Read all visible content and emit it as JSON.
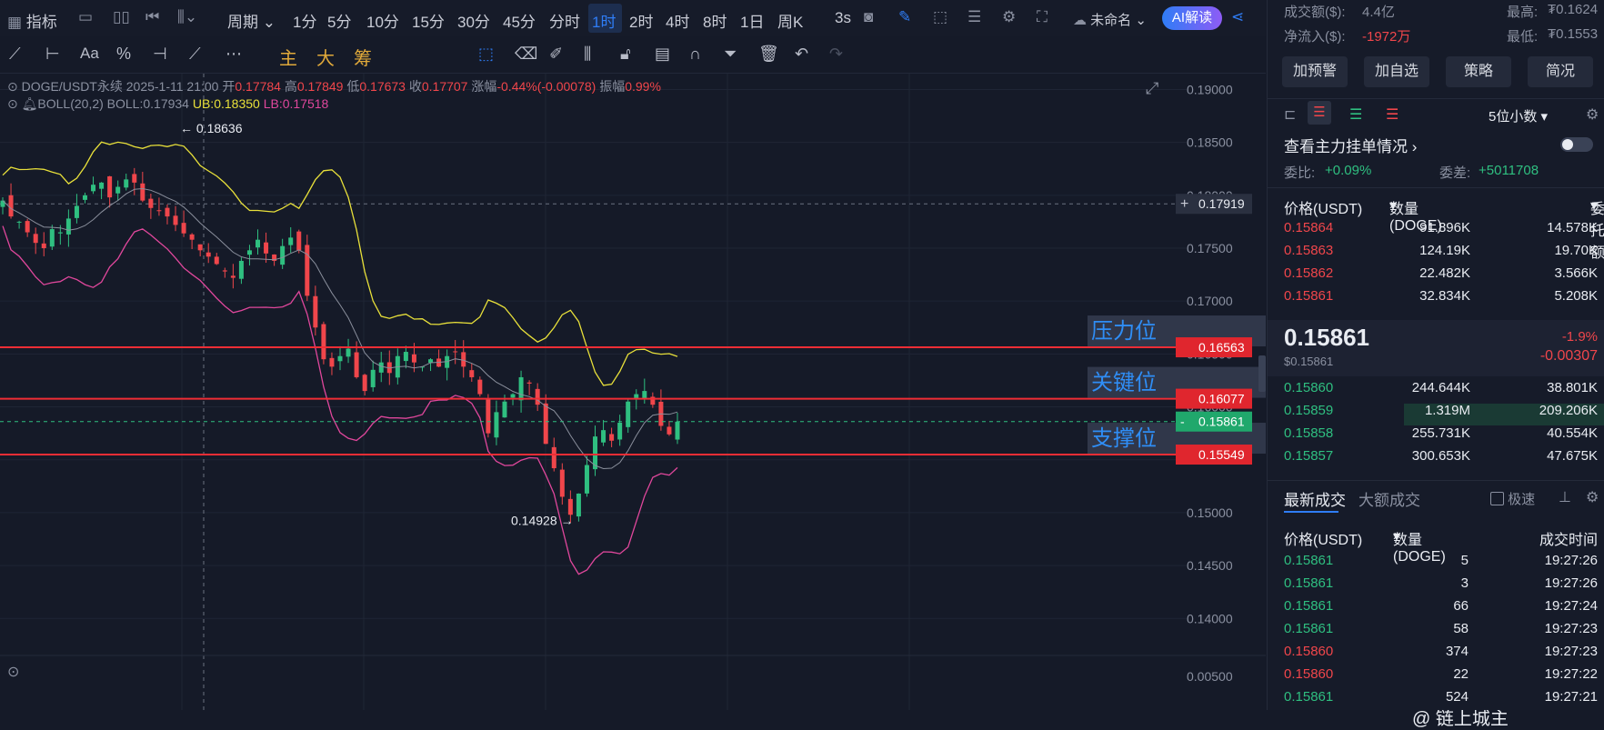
{
  "toolbar": {
    "indicators_label": "指标",
    "period_label": "周期",
    "intervals": [
      "1分",
      "5分",
      "10分",
      "15分",
      "30分",
      "45分",
      "分时",
      "1时",
      "2时",
      "4时",
      "8时",
      "1日",
      "周K"
    ],
    "selected_interval": "1时",
    "refresh_label": "3s",
    "layout_label": "未命名",
    "ai_label": "AI解读"
  },
  "drawing_toolbar": {
    "main_label": "主",
    "large_label": "大",
    "chip_label": "筹"
  },
  "chart_info": {
    "symbol": "DOGE/USDT永续",
    "time": "2025-1-11 21:00",
    "open_label": "开",
    "open": "0.17784",
    "high_label": "高",
    "high": "0.17849",
    "low_label": "低",
    "low": "0.17673",
    "close_label": "收",
    "close": "0.17707",
    "change_label": "涨幅",
    "change": "-0.44%(-0.00078)",
    "amplitude_label": "振幅",
    "amplitude": "0.99%",
    "boll_name": "BOLL(20,2)",
    "boll_mid": "BOLL:0.17934",
    "boll_ub": "UB:0.18350",
    "boll_lb": "LB:0.17518"
  },
  "chart_data": {
    "type": "candlestick",
    "y_ticks": [
      "0.19000",
      "0.18500",
      "0.18000",
      "0.17500",
      "0.17000",
      "0.16500",
      "0.16000",
      "0.15500",
      "0.15000",
      "0.14500",
      "0.14000"
    ],
    "ylim": [
      0.1365,
      0.1915
    ],
    "sub_tick": "0.00500",
    "high_annotation": "0.18636",
    "low_annotation": "0.14928",
    "crosshair_price": "0.17919",
    "current_price": "0.15861",
    "levels": [
      {
        "name": "压力位",
        "price": 0.16563,
        "label": "0.16563"
      },
      {
        "name": "关键位",
        "price": 0.16077,
        "label": "0.16077"
      },
      {
        "name": "支撑位",
        "price": 0.15549,
        "label": "0.15549"
      }
    ],
    "close_path": [
      0.1795,
      0.178,
      0.1775,
      0.1765,
      0.1755,
      0.175,
      0.1768,
      0.1765,
      0.1778,
      0.179,
      0.18,
      0.181,
      0.1812,
      0.1798,
      0.1808,
      0.1815,
      0.1812,
      0.1795,
      0.1788,
      0.1785,
      0.178,
      0.1772,
      0.1764,
      0.1758,
      0.1748,
      0.1742,
      0.1735,
      0.1728,
      0.1722,
      0.1738,
      0.1748,
      0.1758,
      0.1745,
      0.1738,
      0.1752,
      0.176,
      0.1748,
      0.1705,
      0.1675,
      0.1645,
      0.1638,
      0.1648,
      0.1655,
      0.1628,
      0.1615,
      0.1635,
      0.1642,
      0.1632,
      0.1648,
      0.1652,
      0.1642,
      0.1638,
      0.1645,
      0.1638,
      0.1648,
      0.1652,
      0.1638,
      0.1628,
      0.1612,
      0.1575,
      0.1595,
      0.1605,
      0.1612,
      0.1628,
      0.1622,
      0.1602,
      0.1565,
      0.1542,
      0.1515,
      0.1498,
      0.1518,
      0.1545,
      0.1572,
      0.1578,
      0.1568,
      0.1585,
      0.1605,
      0.1612,
      0.1615,
      0.1602,
      0.1582,
      0.1574,
      0.1586
    ]
  },
  "watermark": "@ 链上城主",
  "panel": {
    "turnover_label": "成交额($):",
    "turnover": "4.4亿",
    "high_label": "最高:",
    "high": "₮0.1624",
    "netflow_label": "净流入($):",
    "netflow": "-1972万",
    "low_label": "最低:",
    "low": "₮0.1553",
    "buttons": [
      "加预警",
      "加自选",
      "策略",
      "简况"
    ],
    "decimals_label": "5位小数",
    "orderbook_title": "查看主力挂单情况",
    "ratio_label": "委比:",
    "ratio": "+0.09%",
    "diff_label": "委差:",
    "diff": "+5011708",
    "ob_headers": [
      "价格(USDT)",
      "数量 (DOGE)",
      "委托额"
    ],
    "asks": [
      {
        "price": "0.15864",
        "qty": "91.896K",
        "amt": "14.578K"
      },
      {
        "price": "0.15863",
        "qty": "124.19K",
        "amt": "19.70K"
      },
      {
        "price": "0.15862",
        "qty": "22.482K",
        "amt": "3.566K"
      },
      {
        "price": "0.15861",
        "qty": "32.834K",
        "amt": "5.208K"
      }
    ],
    "last_price": "0.15861",
    "last_usd": "$0.15861",
    "last_pct": "-1.9%",
    "last_change": "-0.00307",
    "bids": [
      {
        "price": "0.15860",
        "qty": "244.644K",
        "amt": "38.801K"
      },
      {
        "price": "0.15859",
        "qty": "1.319M",
        "amt": "209.206K"
      },
      {
        "price": "0.15858",
        "qty": "255.731K",
        "amt": "40.554K"
      },
      {
        "price": "0.15857",
        "qty": "300.653K",
        "amt": "47.675K"
      }
    ],
    "trades_tab": "最新成交",
    "big_trades_tab": "大额成交",
    "fast_label": "极速",
    "trade_headers": [
      "价格(USDT)",
      "数量(DOGE)",
      "成交时间"
    ],
    "trades": [
      {
        "price": "0.15861",
        "qty": "5",
        "time": "19:27:26",
        "side": "buy"
      },
      {
        "price": "0.15861",
        "qty": "3",
        "time": "19:27:26",
        "side": "buy"
      },
      {
        "price": "0.15861",
        "qty": "66",
        "time": "19:27:24",
        "side": "buy"
      },
      {
        "price": "0.15861",
        "qty": "58",
        "time": "19:27:23",
        "side": "buy"
      },
      {
        "price": "0.15860",
        "qty": "374",
        "time": "19:27:23",
        "side": "sell"
      },
      {
        "price": "0.15860",
        "qty": "22",
        "time": "19:27:22",
        "side": "sell"
      },
      {
        "price": "0.15861",
        "qty": "524",
        "time": "19:27:21",
        "side": "buy"
      }
    ]
  },
  "colors": {
    "up": "#2fbf80",
    "down": "#f0464b",
    "accent": "#2f7df6",
    "boll_ub": "#e8e03a",
    "boll_lb": "#e0479c"
  }
}
